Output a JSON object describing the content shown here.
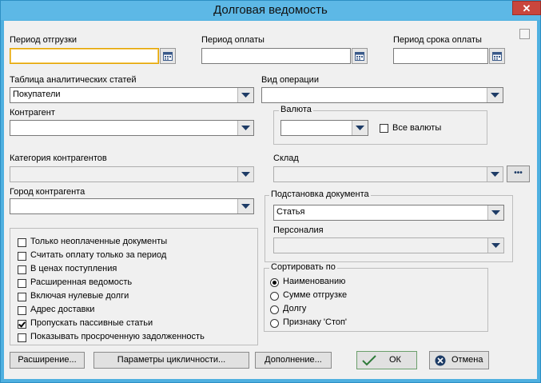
{
  "window": {
    "title": "Долговая ведомость",
    "close_glyph": "✕"
  },
  "fields": {
    "shipment_period": {
      "label": "Период отгрузки",
      "value": ""
    },
    "payment_period": {
      "label": "Период оплаты",
      "value": ""
    },
    "due_period": {
      "label": "Период срока оплаты",
      "value": ""
    },
    "analytics_table": {
      "label": "Таблица аналитических статей",
      "value": "Покупатели"
    },
    "operation_type": {
      "label": "Вид операции",
      "value": ""
    },
    "counterparty": {
      "label": "Контрагент",
      "value": ""
    },
    "counterparty_category": {
      "label": "Категория контрагентов",
      "value": ""
    },
    "counterparty_city": {
      "label": "Город контрагента",
      "value": ""
    },
    "warehouse": {
      "label": "Склад",
      "value": "",
      "more_label": "•••"
    }
  },
  "currency_group": {
    "label": "Валюта",
    "value": "",
    "all_label": "Все валюты"
  },
  "doc_sub_group": {
    "label": "Подстановка документа",
    "article_value": "Статья",
    "personal_label": "Персоналия",
    "personal_value": ""
  },
  "options": [
    {
      "label": "Только неоплаченные документы",
      "checked": false
    },
    {
      "label": "Считать оплату только за период",
      "checked": false
    },
    {
      "label": "В ценах поступления",
      "checked": false
    },
    {
      "label": "Расширенная ведомость",
      "checked": false
    },
    {
      "label": "Включая нулевые долги",
      "checked": false
    },
    {
      "label": "Адрес доставки",
      "checked": false
    },
    {
      "label": "Пропускать пассивные статьи",
      "checked": true
    },
    {
      "label": "Показывать просроченную задолженность",
      "checked": false
    }
  ],
  "sort_group": {
    "label": "Сортировать по",
    "items": [
      {
        "label": "Наименованию",
        "selected": true
      },
      {
        "label": "Сумме отгрузке",
        "selected": false
      },
      {
        "label": "Долгу",
        "selected": false
      },
      {
        "label": "Признаку 'Стоп'",
        "selected": false
      }
    ]
  },
  "buttons": {
    "extension": "Расширение...",
    "cycle_params": "Параметры цикличности...",
    "addition": "Дополнение...",
    "ok": "ОК",
    "cancel": "Отмена"
  },
  "colors": {
    "titlebar": "#5db8e6",
    "close": "#c9463d",
    "focus": "#e3a400"
  }
}
